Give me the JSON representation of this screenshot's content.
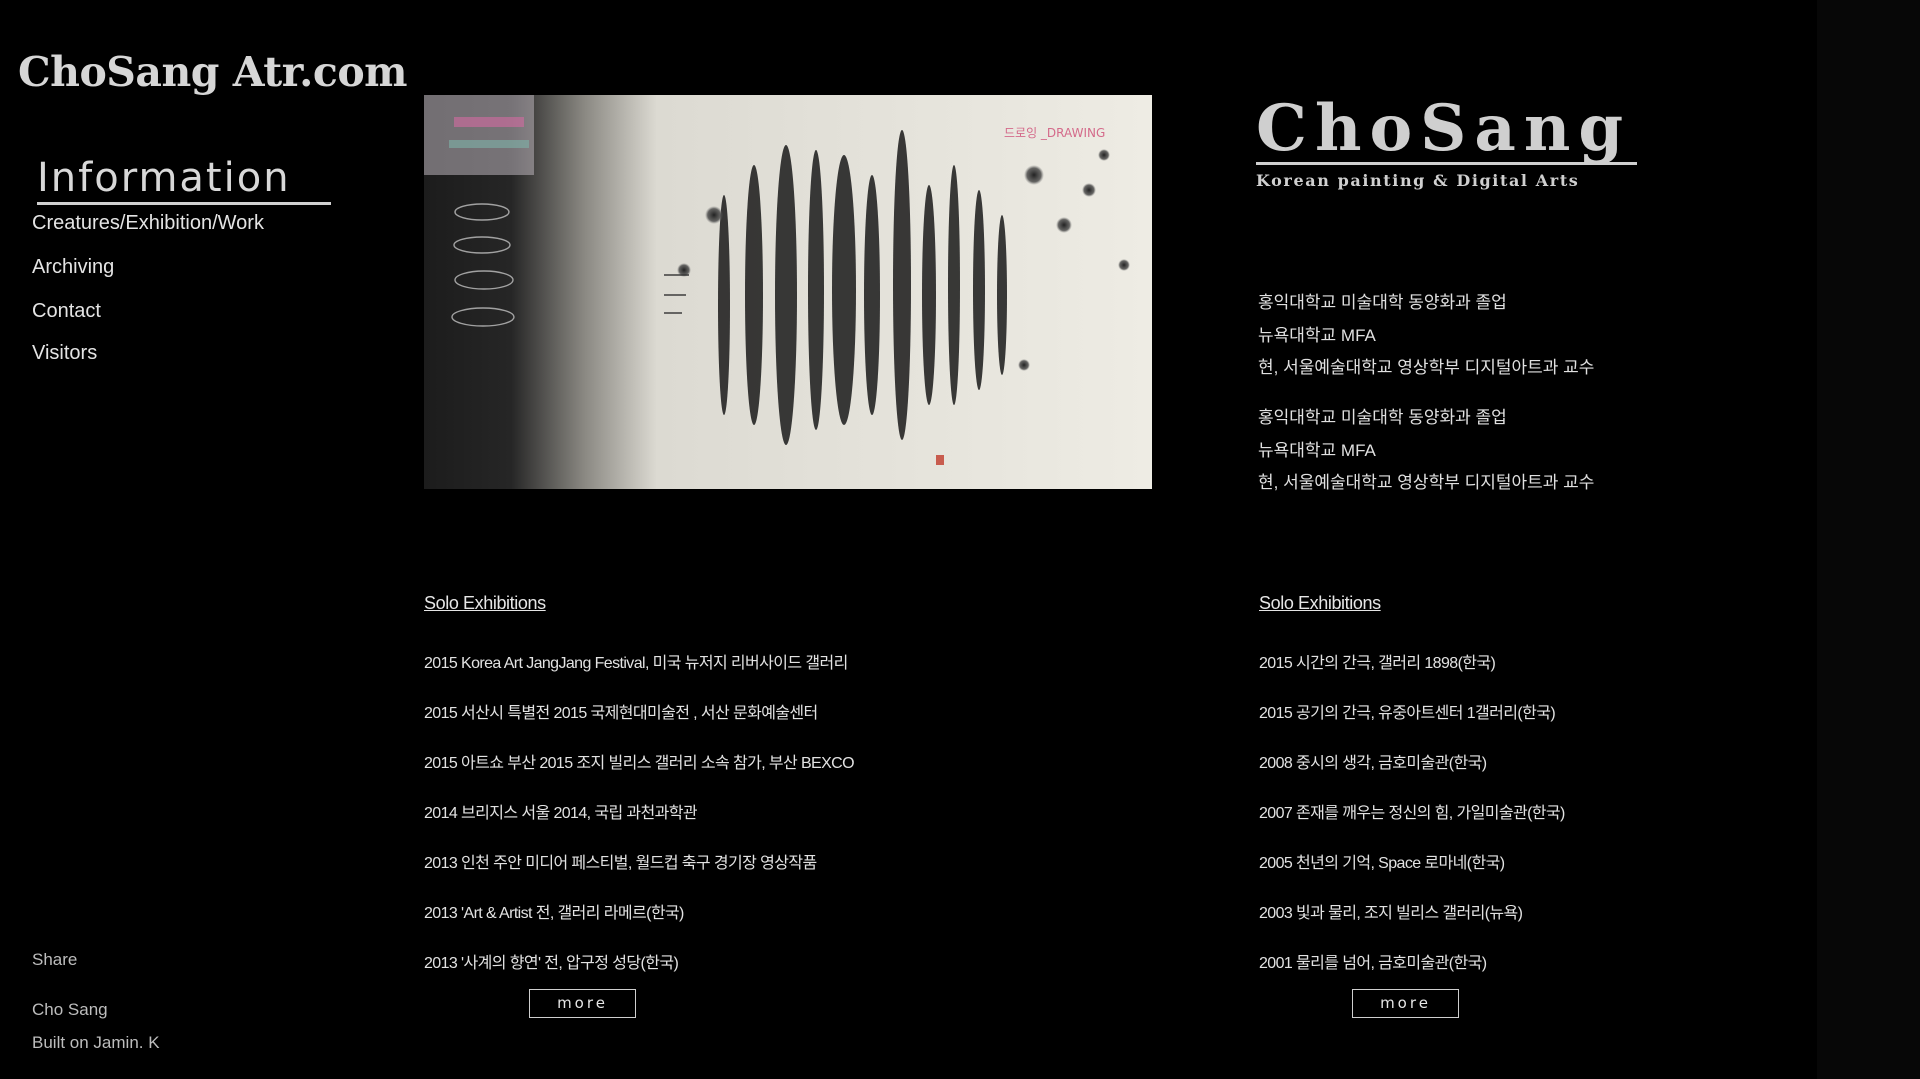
{
  "sidebar": {
    "site_title": "ChoSang Atr.com",
    "nav_heading": "Information",
    "items": [
      {
        "label": "Creatures/Exhibition/Work"
      },
      {
        "label": "Archiving"
      },
      {
        "label": "Contact"
      },
      {
        "label": "Visitors"
      }
    ],
    "share": "Share",
    "author": "Cho Sang",
    "built_on": "Built on Jamin. K"
  },
  "artwork": {
    "caption": "드로잉 _DRAWING"
  },
  "profile": {
    "logo_name": "ChoSang",
    "logo_sub": "Korean painting & Digital Arts",
    "bio_lines": [
      "홍익대학교 미술대학 동양화과 졸업",
      "뉴욕대학교 MFA",
      "현, 서울예술대학교 영상학부 디지털아트과 교수",
      "홍익대학교 미술대학 동양화과 졸업",
      "뉴욕대학교 MFA",
      "현, 서울예술대학교 영상학부 디지털아트과 교수"
    ]
  },
  "exhibitions_left": {
    "heading": "Solo Exhibitions",
    "items": [
      "2015 Korea Art JangJang Festival, 미국 뉴저지 리버사이드 갤러리",
      "2015 서산시 특별전 2015 국제현대미술전 , 서산 문화예술센터",
      "2015 아트쇼 부산 2015 조지 빌리스 갤러리 소속 참가, 부산 BEXCO",
      "2014 브리지스 서울 2014, 국립 과천과학관",
      "2013 인천 주안 미디어 페스티벌, 월드컵 축구 경기장 영상작품",
      "2013 'Art & Artist 전, 갤러리 라메르(한국)",
      "2013 '사계의 향연' 전, 압구정 성당(한국)"
    ],
    "more_label": "more"
  },
  "exhibitions_right": {
    "heading": "Solo Exhibitions",
    "items": [
      "2015 시간의 간극, 갤러리 1898(한국)",
      "2015 공기의 간극, 유중아트센터 1갤러리(한국)",
      "2008 중시의 생각, 금호미술관(한국)",
      "2007 존재를 깨우는 정신의 힘, 가일미술관(한국)",
      "2005 천년의 기억, Space 로마네(한국)",
      "2003 빛과 물리, 조지 빌리스 갤러리(뉴욕)",
      "2001 물리를 넘어, 금호미술관(한국)"
    ],
    "more_label": "more"
  }
}
